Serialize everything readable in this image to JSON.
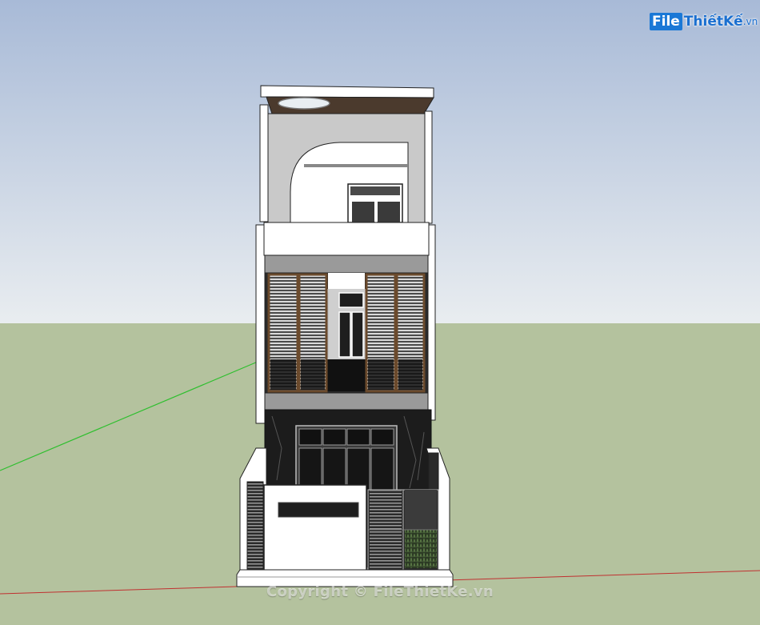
{
  "watermark": {
    "logo_box_text": "File",
    "logo_text": "ThiếtKế",
    "logo_suffix": ".vn",
    "copyright": "Copyright © FileThietKe.vn"
  },
  "colors": {
    "sky_top": "#a9bbd8",
    "sky_bottom": "#e8ecf0",
    "ground": "#b4c29e",
    "axis_green": "#2fbf2f",
    "axis_red": "#c03030",
    "marble": "#1c1c1c",
    "wood": "#6b4a2c",
    "wall": "#ffffff"
  }
}
